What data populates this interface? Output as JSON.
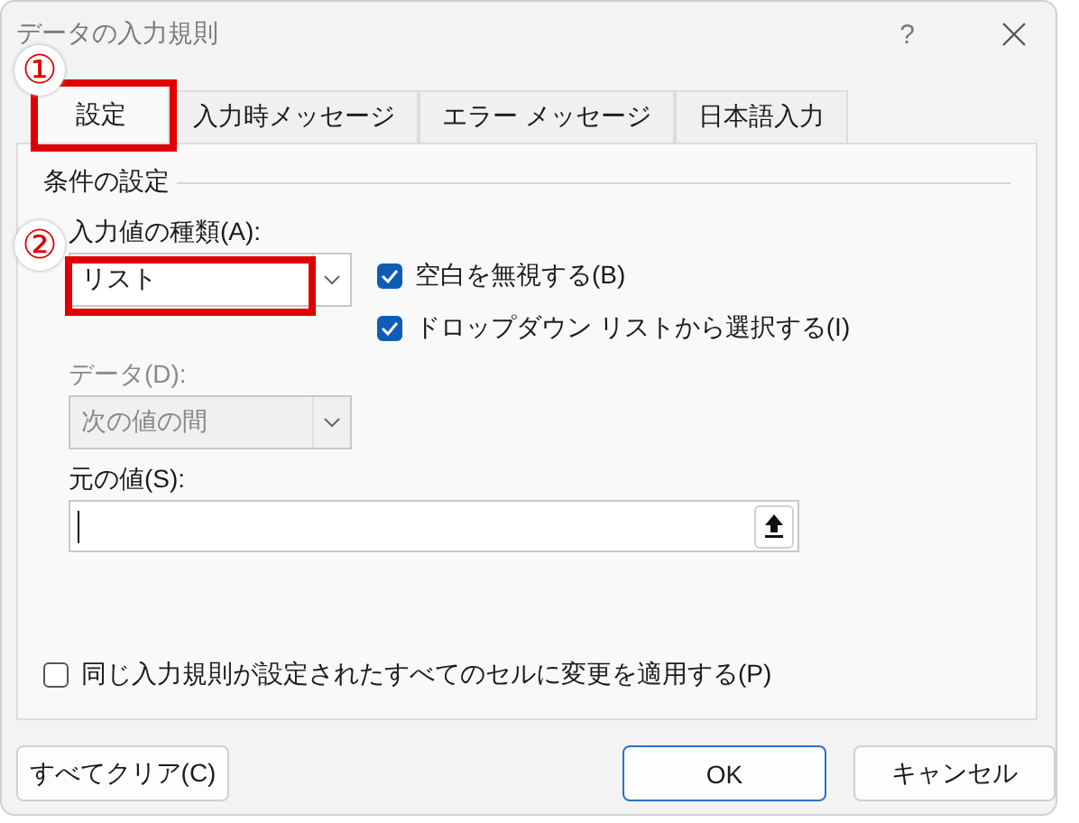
{
  "window": {
    "title": "データの入力規則",
    "help": "?"
  },
  "tabs": [
    {
      "label": "設定",
      "selected": true,
      "callout": "①"
    },
    {
      "label": "入力時メッセージ",
      "selected": false
    },
    {
      "label": "エラー メッセージ",
      "selected": false
    },
    {
      "label": "日本語入力",
      "selected": false
    }
  ],
  "section": "条件の設定",
  "allow": {
    "label": "入力値の種類(A):",
    "value": "リスト",
    "callout": "②"
  },
  "options": [
    {
      "label": "空白を無視する(B)",
      "checked": true
    },
    {
      "label": "ドロップダウン リストから選択する(I)",
      "checked": true
    }
  ],
  "data": {
    "label": "データ(D):",
    "value": "次の値の間",
    "disabled": true
  },
  "source": {
    "label": "元の値(S):"
  },
  "apply_all": {
    "label": "同じ入力規則が設定されたすべてのセルに変更を適用する(P)",
    "checked": false
  },
  "buttons": [
    {
      "label": "すべてクリア(C)",
      "kind": "secondary"
    },
    {
      "label": "OK",
      "kind": "default"
    },
    {
      "label": "キャンセル",
      "kind": "secondary"
    }
  ]
}
